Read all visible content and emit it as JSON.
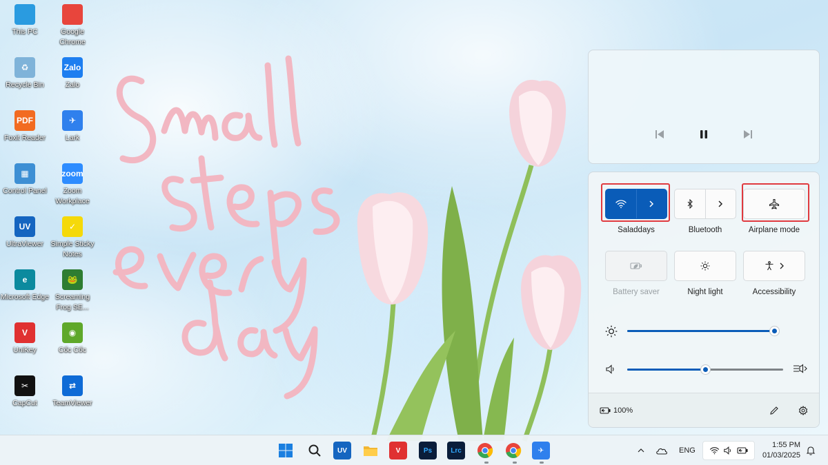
{
  "desktop": {
    "icons": [
      {
        "label": "This PC",
        "glyph": "",
        "color": "#2a9be0",
        "icon": "monitor-icon"
      },
      {
        "label": "Google Chrome",
        "glyph": "",
        "color": "#e8453c",
        "icon": "chrome-icon"
      },
      {
        "label": "Recycle Bin",
        "glyph": "♻",
        "color": "#7fb3d9",
        "icon": "recycle-bin-icon"
      },
      {
        "label": "Zalo",
        "glyph": "Zalo",
        "color": "#1d7ef0",
        "icon": "zalo-icon"
      },
      {
        "label": "Foxit Reader",
        "glyph": "PDF",
        "color": "#f26b21",
        "icon": "foxit-icon"
      },
      {
        "label": "Lark",
        "glyph": "✈",
        "color": "#2f80ed",
        "icon": "lark-icon"
      },
      {
        "label": "Control Panel",
        "glyph": "▦",
        "color": "#3d8fd4",
        "icon": "control-panel-icon"
      },
      {
        "label": "Zoom Workplace",
        "glyph": "zoom",
        "color": "#2d8cff",
        "icon": "zoom-icon"
      },
      {
        "label": "UltraViewer",
        "glyph": "UV",
        "color": "#1565c0",
        "icon": "ultraviewer-icon"
      },
      {
        "label": "Simple Sticky Notes",
        "glyph": "✓",
        "color": "#f5d90a",
        "icon": "sticky-notes-icon"
      },
      {
        "label": "Microsoft Edge",
        "glyph": "e",
        "color": "#0c8a9e",
        "icon": "edge-icon"
      },
      {
        "label": "Screaming Frog SE...",
        "glyph": "🐸",
        "color": "#2e7d32",
        "icon": "screaming-frog-icon"
      },
      {
        "label": "UniKey",
        "glyph": "V",
        "color": "#e03131",
        "icon": "unikey-icon"
      },
      {
        "label": "Cốc Cốc",
        "glyph": "◉",
        "color": "#5fa82a",
        "icon": "coccoc-icon"
      },
      {
        "label": "CapCut",
        "glyph": "✂",
        "color": "#111111",
        "icon": "capcut-icon"
      },
      {
        "label": "TeamViewer",
        "glyph": "⇄",
        "color": "#0e6bd6",
        "icon": "teamviewer-icon"
      }
    ]
  },
  "media": {
    "prev_label": "Previous",
    "play_label": "Pause",
    "next_label": "Next"
  },
  "quick_settings": {
    "tiles": [
      {
        "label": "Saladdays",
        "state": "on"
      },
      {
        "label": "Bluetooth",
        "state": "off"
      },
      {
        "label": "Airplane mode",
        "state": "off"
      },
      {
        "label": "Battery saver",
        "state": "disabled"
      },
      {
        "label": "Night light",
        "state": "off"
      },
      {
        "label": "Accessibility",
        "state": "off"
      }
    ],
    "brightness": 0.98,
    "volume": 0.5,
    "battery": "100%"
  },
  "taskbar": {
    "apps": [
      {
        "name": "start-button",
        "glyph": "",
        "color": "#1a7fe0"
      },
      {
        "name": "search-button",
        "glyph": "",
        "color": "transparent"
      },
      {
        "name": "taskbar-ultraviewer",
        "glyph": "UV",
        "color": "#1565c0"
      },
      {
        "name": "taskbar-file-explorer",
        "glyph": "",
        "color": "#f2b632"
      },
      {
        "name": "taskbar-unikey",
        "glyph": "V",
        "color": "#e03131"
      },
      {
        "name": "taskbar-photoshop",
        "glyph": "Ps",
        "color": "#0a1d3a"
      },
      {
        "name": "taskbar-lightroom",
        "glyph": "Lrc",
        "color": "#0a1d3a"
      },
      {
        "name": "taskbar-chrome-1",
        "glyph": "",
        "color": "#e8453c"
      },
      {
        "name": "taskbar-chrome-2",
        "glyph": "",
        "color": "#e8453c"
      },
      {
        "name": "taskbar-lark",
        "glyph": "✈",
        "color": "#2f80ed"
      }
    ],
    "language": "ENG",
    "time": "1:55 PM",
    "date": "01/03/2025"
  }
}
